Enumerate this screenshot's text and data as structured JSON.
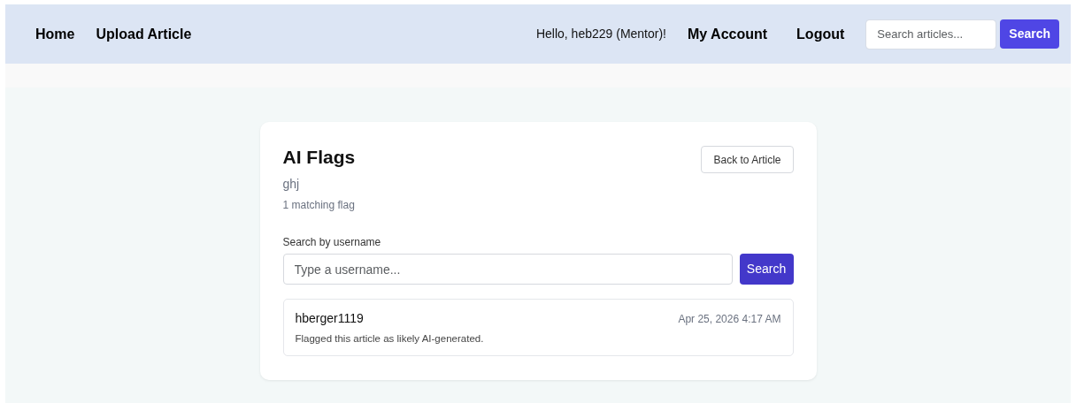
{
  "nav": {
    "links": [
      "Home",
      "Upload Article"
    ],
    "greeting": "Hello, heb229 (Mentor)!",
    "account_links": [
      "My Account",
      "Logout"
    ],
    "search": {
      "placeholder": "Search articles...",
      "button": "Search"
    }
  },
  "panel": {
    "title": "AI Flags",
    "subtitle": "ghj",
    "count": "1 matching flag",
    "back_button": "Back to Article",
    "filter": {
      "label": "Search by username",
      "placeholder": "Type a username...",
      "button": "Search"
    },
    "flags": [
      {
        "user": "hberger1119",
        "time": "Apr 25, 2026 4:17 AM",
        "message": "Flagged this article as likely AI-generated."
      }
    ]
  }
}
